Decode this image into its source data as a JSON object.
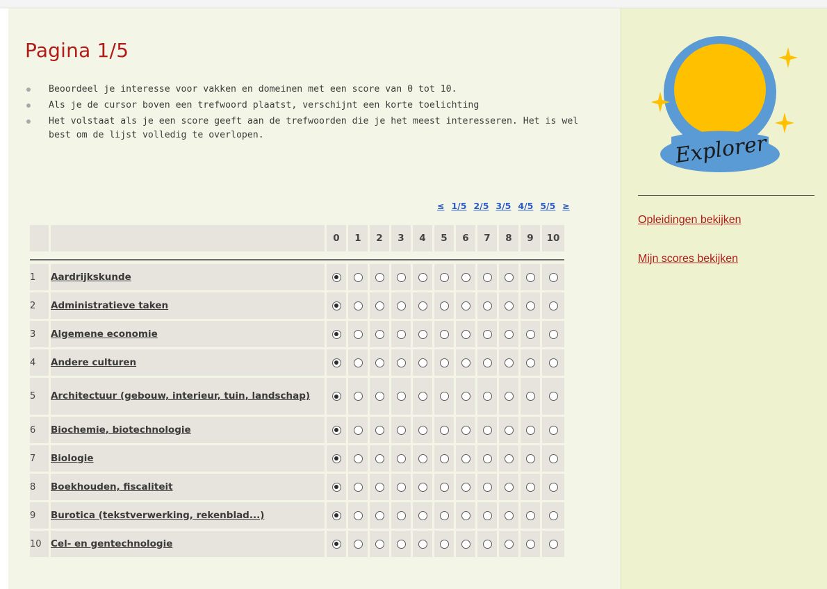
{
  "page": {
    "title": "Pagina 1/5",
    "instructions": [
      "Beoordeel je interesse voor vakken en domeinen met een score van 0 tot 10.",
      "Als je de cursor boven een trefwoord plaatst, verschijnt een korte toelichting",
      "Het volstaat als je een score geeft aan de trefwoorden die je het meest interesseren. Het is wel best om de lijst volledig te overlopen."
    ]
  },
  "pager": {
    "prev": "≤",
    "pages": [
      "1/5",
      "2/5",
      "3/5",
      "4/5",
      "5/5"
    ],
    "next": "≥"
  },
  "table": {
    "score_headers": [
      "0",
      "1",
      "2",
      "3",
      "4",
      "5",
      "6",
      "7",
      "8",
      "9",
      "10"
    ],
    "rows": [
      {
        "num": "1",
        "label": "Aardrijkskunde",
        "selected": 0
      },
      {
        "num": "2",
        "label": "Administratieve taken",
        "selected": 0
      },
      {
        "num": "3",
        "label": "Algemene economie",
        "selected": 0
      },
      {
        "num": "4",
        "label": "Andere culturen",
        "selected": 0
      },
      {
        "num": "5",
        "label": "Architectuur (gebouw, interieur, tuin, landschap)",
        "selected": 0
      },
      {
        "num": "6",
        "label": "Biochemie, biotechnologie",
        "selected": 0
      },
      {
        "num": "7",
        "label": "Biologie",
        "selected": 0
      },
      {
        "num": "8",
        "label": "Boekhouden, fiscaliteit",
        "selected": 0
      },
      {
        "num": "9",
        "label": "Burotica (tekstverwerking, rekenblad...)",
        "selected": 0
      },
      {
        "num": "10",
        "label": "Cel- en gentechnologie",
        "selected": 0
      }
    ]
  },
  "sidebar": {
    "logo_text": "Explorer",
    "links": [
      "Opleidingen bekijken",
      "Mijn scores bekijken"
    ]
  },
  "colors": {
    "accent_red": "#b01c17",
    "link_blue": "#2f5bc8",
    "globe_blue": "#5b9bd5",
    "globe_yellow": "#ffc000"
  }
}
